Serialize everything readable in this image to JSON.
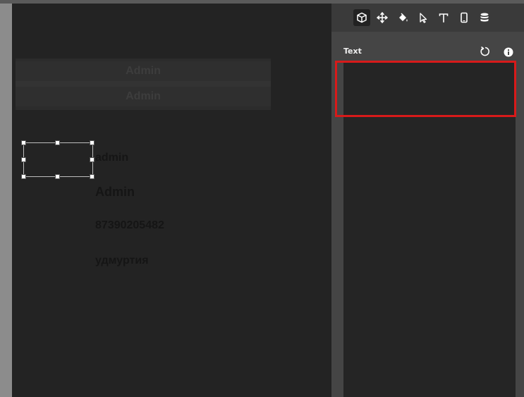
{
  "canvas": {
    "nav": [
      "Admin",
      "Admin"
    ],
    "fields": [
      "admin",
      "Admin",
      "87390205482",
      "удмуртия"
    ]
  },
  "panel": {
    "section_title": "Text",
    "tools": [
      "cube-icon",
      "move-icon",
      "paint-bucket-icon",
      "pointer-icon",
      "text-icon",
      "mobile-icon",
      "database-icon"
    ]
  },
  "colors": {
    "highlight": "#d81a1a",
    "panel_bg": "#454545",
    "canvas_bg": "#232323"
  }
}
